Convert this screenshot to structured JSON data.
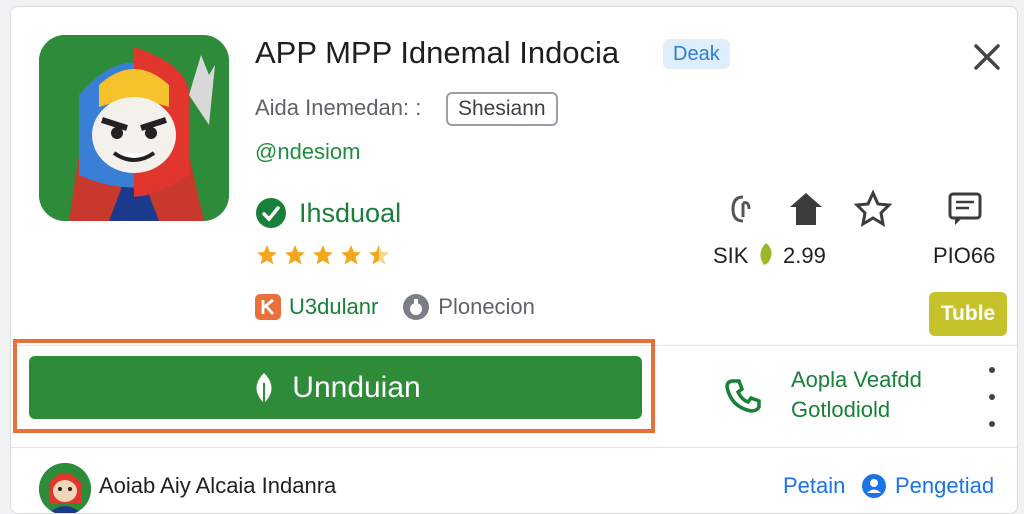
{
  "app": {
    "title": "APP MPP Idnemal Indocia",
    "title_badge": "Deak",
    "developer": "Aida Inemedan: :",
    "developer_chip": "Shesiann",
    "handle": "@ndesiom",
    "verified_label": "Ihsduoal",
    "rating_stars": 4.5,
    "tag_orange": "U3dulanr",
    "tag_gray": "Plonecion"
  },
  "stats": {
    "stat1": "SIK",
    "stat2": "2.99",
    "stat3": "PIO66",
    "tag_button": "Tuble"
  },
  "install": {
    "label": "Unnduian"
  },
  "side_action": {
    "line1": "Aopla Veafdd",
    "line2": "Gotlodiold"
  },
  "bottom": {
    "name": "Aoiab Aiy Alcaia Indanra",
    "link1": "Petain",
    "link2": "Pengetiad"
  },
  "colors": {
    "accent_green": "#2e8b37",
    "highlight_orange": "#e8703a",
    "link_blue": "#1a73e8",
    "badge_olive": "#c6c22b"
  },
  "icons": {
    "close": "close-icon",
    "verified": "check-circle-icon",
    "stat1": "touch-icon",
    "stat2": "house-icon",
    "stat3": "star-outline-icon",
    "stat4": "message-icon",
    "install": "leaf-icon",
    "side": "phone-icon",
    "more": "more-vert-icon"
  }
}
